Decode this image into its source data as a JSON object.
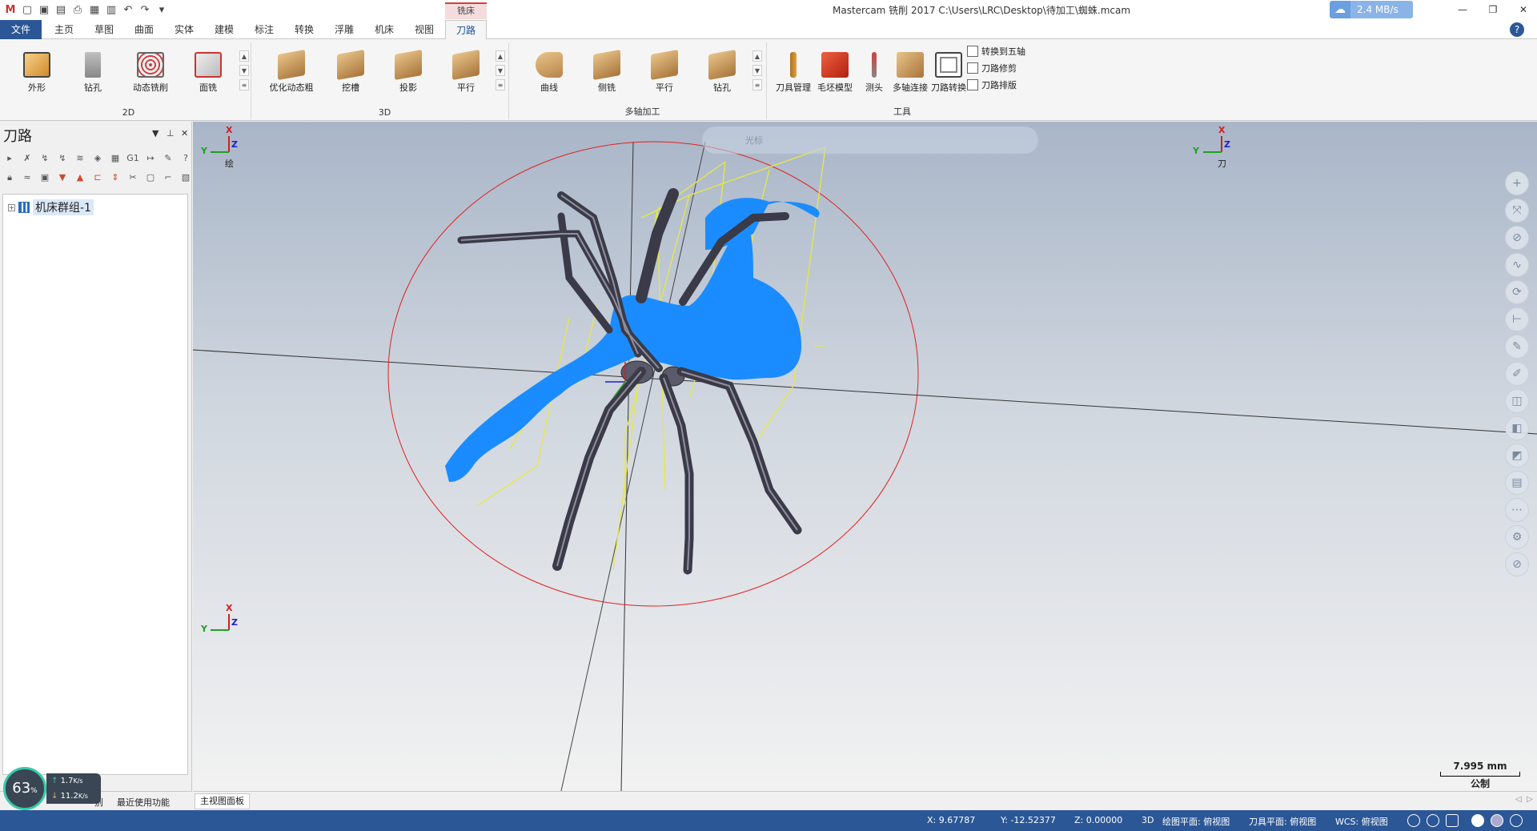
{
  "window": {
    "title": "Mastercam 铣削 2017  C:\\Users\\LRC\\Desktop\\待加工\\蜘蛛.mcam",
    "net_speed": "2.4 MB/s"
  },
  "tabs": {
    "file": "文件",
    "items": [
      "主页",
      "草图",
      "曲面",
      "实体",
      "建模",
      "标注",
      "转换",
      "浮雕",
      "机床",
      "视图"
    ],
    "context_group": "铣床",
    "active": "刀路"
  },
  "ribbon": {
    "group_2d": {
      "label": "2D",
      "buttons": [
        "外形",
        "钻孔",
        "动态铣削",
        "面铣"
      ]
    },
    "group_3d": {
      "label": "3D",
      "buttons": [
        "优化动态粗",
        "挖槽",
        "投影",
        "平行"
      ]
    },
    "group_multiaxis": {
      "label": "多轴加工",
      "buttons": [
        "曲线",
        "侧铣",
        "平行",
        "钻孔"
      ]
    },
    "group_tools": {
      "label": "工具",
      "buttons": [
        "刀具管理",
        "毛坯模型",
        "测头",
        "多轴连接",
        "刀路转换"
      ],
      "small": [
        "转换到五轴",
        "刀路修剪",
        "刀路排版"
      ]
    }
  },
  "left_panel": {
    "title": "刀路",
    "tree_root": "机床群组-1",
    "bottom_tabs": [
      "别",
      "最近使用功能"
    ]
  },
  "meter": {
    "percent": "63",
    "up": "1.7",
    "down": "11.2",
    "unit": "K/s"
  },
  "viewport": {
    "toolbar_hint": "光标",
    "gnomon_top_left_label": "绘",
    "gnomon_top_right_label": "刀",
    "axis_x": "X",
    "axis_y": "Y",
    "axis_z": "Z",
    "scale_value": "7.995 mm",
    "scale_unit": "公制",
    "view_tab": "主视图面板"
  },
  "status": {
    "x": "X:  9.67787",
    "y": "Y:  -12.52377",
    "z": "Z:  0.00000",
    "mode": "3D",
    "gplane": "绘图平面: 俯视图",
    "tplane": "刀具平面: 俯视图",
    "wcs": "WCS: 俯视图"
  }
}
